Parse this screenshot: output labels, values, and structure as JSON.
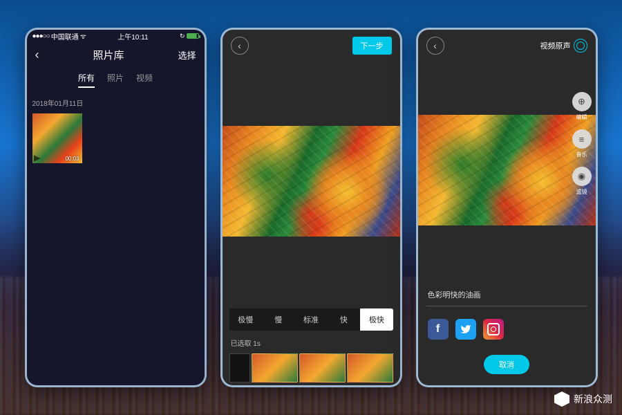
{
  "watermark": "新浪众测",
  "screen1": {
    "status": {
      "carrier": "中国联通",
      "signal": "●●●○○",
      "wifi": "⚪",
      "time": "上午10:11"
    },
    "nav": {
      "title": "照片库",
      "select": "选择"
    },
    "tabs": {
      "all": "所有",
      "photo": "照片",
      "video": "视频"
    },
    "date": "2018年01月11日",
    "thumb_time": "00:03"
  },
  "screen2": {
    "next": "下一步",
    "speeds": {
      "s1": "极慢",
      "s2": "慢",
      "s3": "标准",
      "s4": "快",
      "s5": "极快"
    },
    "selected": "已选取 1s"
  },
  "screen3": {
    "audio": "视频原声",
    "tools": {
      "edit": "编辑",
      "music": "音乐",
      "filter": "滤镜"
    },
    "caption": "色彩明快的油画",
    "cancel": "取消"
  }
}
